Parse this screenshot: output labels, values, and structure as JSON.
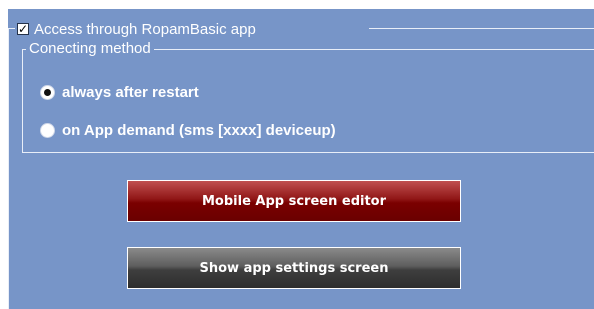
{
  "access_group": {
    "checkbox_checked": true,
    "legend_label": "Access through RopamBasic app"
  },
  "connecting_group": {
    "legend_label": "Conecting method",
    "options": [
      {
        "label": "always after restart",
        "selected": true
      },
      {
        "label": "on App demand (sms [xxxx] deviceup)",
        "selected": false
      }
    ]
  },
  "buttons": {
    "editor_label": "Mobile App screen editor",
    "settings_label": "Show app settings screen"
  },
  "colors": {
    "panel_bg": "#7795c8",
    "editor_button": "#8b0000",
    "settings_button": "#3e3e3e"
  }
}
